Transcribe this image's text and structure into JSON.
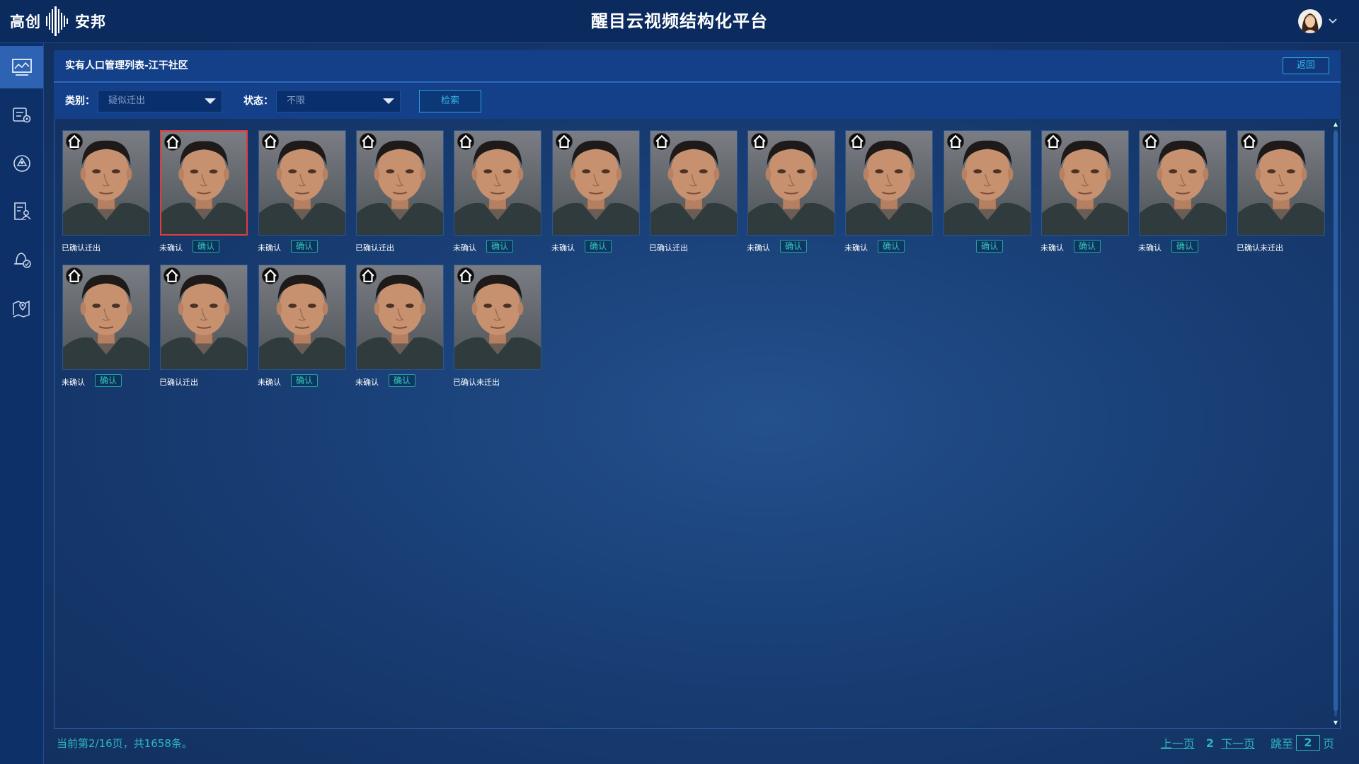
{
  "header": {
    "logo_left": "高创",
    "logo_right": "安邦",
    "title": "醒目云视频结构化平台"
  },
  "sidebar": {
    "items": [
      {
        "icon": "monitor-chart-icon",
        "active": true
      },
      {
        "icon": "server-settings-icon",
        "active": false
      },
      {
        "icon": "network-node-icon",
        "active": false
      },
      {
        "icon": "document-person-icon",
        "active": false
      },
      {
        "icon": "alarm-bell-icon",
        "active": false
      },
      {
        "icon": "map-pin-icon",
        "active": false
      }
    ]
  },
  "panel": {
    "title": "实有人口管理列表-江干社区",
    "back_label": "返回"
  },
  "filters": {
    "category_label": "类别：",
    "category_value": "疑似迁出",
    "status_label": "状态：",
    "status_value": "不限",
    "search_label": "检索"
  },
  "cards": [
    {
      "status": "已确认迁出",
      "confirm": "",
      "selected": false
    },
    {
      "status": "未确认",
      "confirm": "确认",
      "selected": true
    },
    {
      "status": "未确认",
      "confirm": "确认",
      "selected": false
    },
    {
      "status": "已确认迁出",
      "confirm": "",
      "selected": false
    },
    {
      "status": "未确认",
      "confirm": "确认",
      "selected": false
    },
    {
      "status": "未确认",
      "confirm": "确认",
      "selected": false
    },
    {
      "status": "已确认迁出",
      "confirm": "",
      "selected": false
    },
    {
      "status": "未确认",
      "confirm": "确认",
      "selected": false
    },
    {
      "status": "未确认",
      "confirm": "确认",
      "selected": false
    },
    {
      "status": "",
      "confirm": "确认",
      "selected": false
    },
    {
      "status": "未确认",
      "confirm": "确认",
      "selected": false
    },
    {
      "status": "未确认",
      "confirm": "确认",
      "selected": false
    },
    {
      "status": "已确认未迁出",
      "confirm": "",
      "selected": false
    },
    {
      "status": "未确认",
      "confirm": "确认",
      "selected": false
    },
    {
      "status": "已确认迁出",
      "confirm": "",
      "selected": false
    },
    {
      "status": "未确认",
      "confirm": "确认",
      "selected": false
    },
    {
      "status": "未确认",
      "confirm": "确认",
      "selected": false
    },
    {
      "status": "已确认未迁出",
      "confirm": "",
      "selected": false
    }
  ],
  "footer": {
    "info": "当前第2/16页，共1658条。",
    "prev": "上一页",
    "current": "2",
    "next": "下一页",
    "jump_label": "跳至",
    "jump_value": "2",
    "page_suffix": "页"
  },
  "colors": {
    "accent": "#2cb6c3",
    "selected_border": "#e13c3c",
    "header_bg": "#0b2a5e"
  }
}
